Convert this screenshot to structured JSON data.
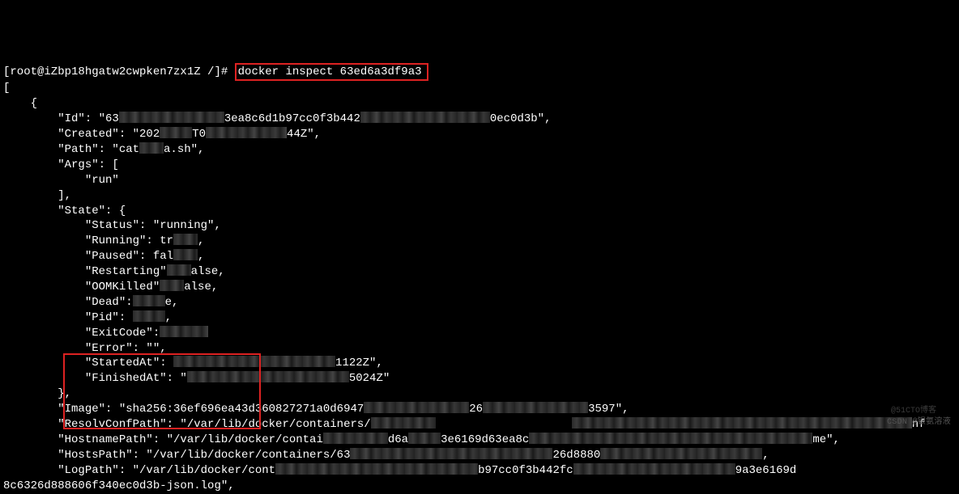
{
  "prompt": {
    "user_host": "[root@iZbp18hgatw2cwpken7zx1Z /]#",
    "command": "docker inspect 63ed6a3df9a3"
  },
  "open_bracket": "[",
  "indent_open_brace": "    {",
  "id_line": {
    "prefix": "        \"Id\": \"63",
    "mid": "3ea8c6d1b97cc0f3b442",
    "suffix": "0ec0d3b\","
  },
  "created_line": {
    "prefix": "        \"Created\": \"202",
    "mid": "T0",
    "suffix": "44Z\","
  },
  "path_line": {
    "prefix": "        \"Path\": \"cat",
    "suffix": "a.sh\","
  },
  "args_open": "        \"Args\": [",
  "args_run": "            \"run\"",
  "args_close": "        ],",
  "state_open": "        \"State\": {",
  "state_status": "            \"Status\": \"running\",",
  "state_running_prefix": "            \"Running\": tr",
  "state_running_suffix": ",",
  "state_paused_prefix": "            \"Paused\": fal",
  "state_paused_suffix": ",",
  "state_restarting_prefix": "            \"Restarting\"",
  "state_restarting_suffix": "alse,",
  "state_oom_prefix": "            \"OOMKilled\"",
  "state_oom_suffix": "alse,",
  "state_dead_prefix": "            \"Dead\":",
  "state_dead_suffix": "e,",
  "state_pid_prefix": "            \"Pid\": ",
  "state_pid_suffix": ",",
  "state_exitcode_prefix": "            \"ExitCode\":",
  "state_exitcode_suffix": "",
  "state_error": "            \"Error\": \"\",",
  "state_started_prefix": "            \"StartedAt\": ",
  "state_started_suffix": "1122Z\",",
  "state_finished_prefix": "            \"FinishedAt\": \"",
  "state_finished_suffix": "5024Z\"",
  "state_close": "        },",
  "image_line": {
    "prefix": "        \"Image\": \"sha256:36ef696ea43",
    "mid": "d360827271a0d6947",
    "mid2": "26",
    "suffix": "3597\","
  },
  "resolv_line": {
    "prefix": "        \"ResolvConfPath\": \"/var/lib/docker/containers/",
    "suffix": "nf"
  },
  "hostname_line": {
    "prefix": "        \"HostnamePath\": \"/var/lib/docker/contai",
    "mid": "d6a",
    "mid2": "3e6169d63ea8c",
    "suffix": "me\","
  },
  "hosts_line": {
    "prefix": "        \"HostsPath\": \"/var/lib/docker/containers/63",
    "mid": "26d8880",
    "suffix": ","
  },
  "logpath_line": {
    "prefix": "        \"LogPath\": \"/var/lib/docker/cont",
    "mid": "b97cc0f3b442fc",
    "suffix": "9a3e6169d"
  },
  "logpath_line2": "8c6326d888606f340ec0d3b-json.log\",",
  "watermark": "CSDN @银氨溶液",
  "watermark2": "@51CTO博客"
}
